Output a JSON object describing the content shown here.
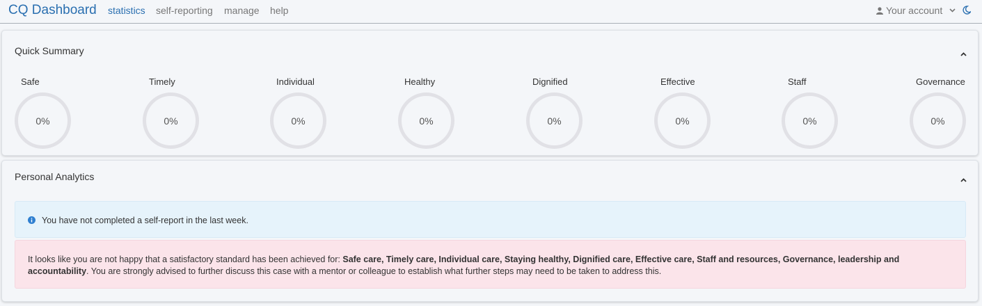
{
  "navbar": {
    "brand": "CQ Dashboard",
    "links": [
      "statistics",
      "self-reporting",
      "manage",
      "help"
    ],
    "active_link": "statistics",
    "account_label": "Your account",
    "accent_color": "#2a6fb0"
  },
  "quick_summary": {
    "title": "Quick Summary",
    "gauges": [
      {
        "label": "Safe",
        "value": "0%"
      },
      {
        "label": "Timely",
        "value": "0%"
      },
      {
        "label": "Individual",
        "value": "0%"
      },
      {
        "label": "Healthy",
        "value": "0%"
      },
      {
        "label": "Dignified",
        "value": "0%"
      },
      {
        "label": "Effective",
        "value": "0%"
      },
      {
        "label": "Staff",
        "value": "0%"
      },
      {
        "label": "Governance",
        "value": "0%"
      }
    ]
  },
  "personal_analytics": {
    "title": "Personal Analytics",
    "info_message": "You have not completed a self-report in the last week.",
    "warning": {
      "prefix": "It looks like you are not happy that a satisfactory standard has been achieved for: ",
      "areas": "Safe care, Timely care, Individual care, Staying healthy, Dignified care, Effective care, Staff and resources, Governance, leadership and accountability",
      "suffix": ". You are strongly advised to further discuss this case with a mentor or colleague to establish what further steps may need to be taken to address this."
    }
  }
}
